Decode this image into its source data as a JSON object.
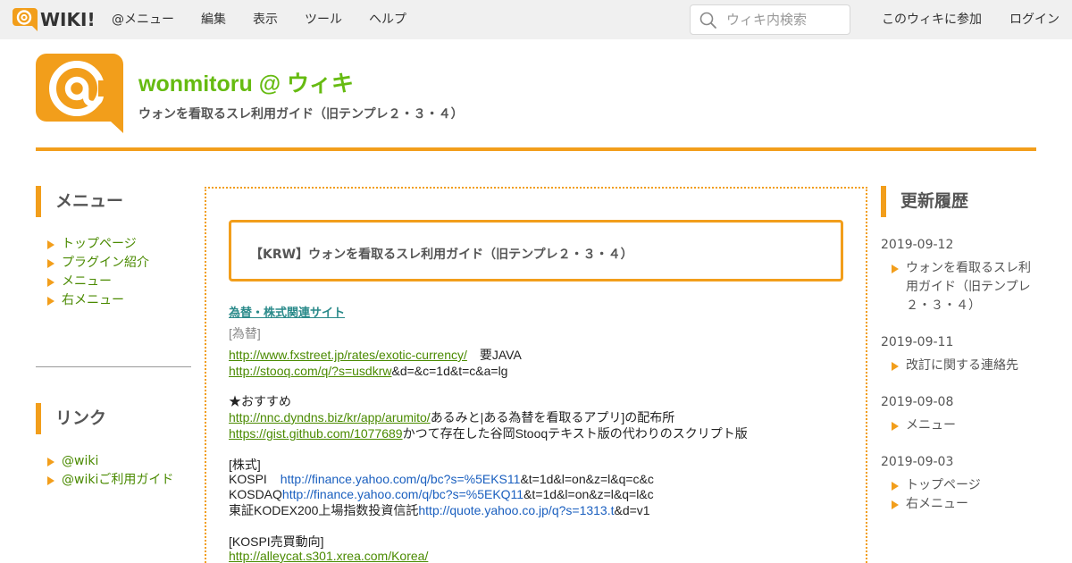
{
  "topbar": {
    "logo_text": "WIKI!",
    "menu": [
      "@メニュー",
      "編集",
      "表示",
      "ツール",
      "ヘルプ"
    ],
    "search_placeholder": "ウィキ内検索",
    "join_label": "このウィキに参加",
    "login_label": "ログイン"
  },
  "header": {
    "title": "wonmitoru @ ウィキ",
    "subtitle": "ウォンを看取るスレ利用ガイド（旧テンプレ２・３・４）"
  },
  "left_sidebar": {
    "menu_heading": "メニュー",
    "menu_items": [
      "トップページ",
      "プラグイン紹介",
      "メニュー",
      "右メニュー"
    ],
    "links_heading": "リンク",
    "link_items": [
      "@wiki",
      "@wikiご利用ガイド"
    ]
  },
  "main": {
    "page_title": "【KRW】ウォンを看取るスレ利用ガイド（旧テンプレ２・３・４）",
    "section_title": "為替・株式関連サイト",
    "fx_label": "[為替]",
    "fx1_link": "http://www.fxstreet.jp/rates/exotic-currency/",
    "fx1_note": "要JAVA",
    "fx2_link": "http://stooq.com/q/?s=usdkrw",
    "fx2_rest": "&d=&c=1d&t=c&a=lg",
    "rec_label": "★おすすめ",
    "rec1_link": "http://nnc.dyndns.biz/kr/app/arumito/",
    "rec1_text": "あるみと|ある為替を看取るアプリ]の配布所",
    "rec2_link": "https://gist.github.com/1077689",
    "rec2_text": "かつて存在した谷岡Stooqテキスト版の代わりのスクリプト版",
    "stock_label": "[株式]",
    "kospi_label": "KOSPI",
    "kospi_link": "http://finance.yahoo.com/q/bc?s=%5EKS11",
    "kospi_rest": "&t=1d&l=on&z=l&q=c&c",
    "kosdaq_label": "KOSDAQ",
    "kosdaq_link": "http://finance.yahoo.com/q/bc?s=%5EKQ11",
    "kosdaq_rest": "&t=1d&l=on&z=l&q=l&c",
    "kodex_label": "東証KODEX200上場指数投資信託",
    "kodex_link": "http://quote.yahoo.co.jp/q?s=1313.t",
    "kodex_rest": "&d=v1",
    "kospi_trend_label": "[KOSPI売買動向]",
    "kospi_trend_link": "http://alleycat.s301.xrea.com/Korea/"
  },
  "right_sidebar": {
    "heading": "更新履歴",
    "entries": [
      {
        "date": "2019-09-12",
        "items": [
          "ウォンを看取るスレ利用ガイド（旧テンプレ２・３・４）"
        ]
      },
      {
        "date": "2019-09-11",
        "items": [
          "改訂に関する連絡先"
        ]
      },
      {
        "date": "2019-09-08",
        "items": [
          "メニュー"
        ]
      },
      {
        "date": "2019-09-03",
        "items": [
          "トップページ",
          "右メニュー"
        ]
      }
    ]
  },
  "colors": {
    "accent_orange": "#f29e1b",
    "title_green": "#66bb11",
    "link_green": "#4a8a00",
    "link_blue": "#1a5fbf"
  }
}
